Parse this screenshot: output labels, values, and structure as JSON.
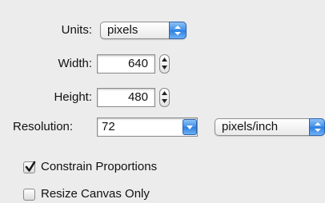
{
  "units": {
    "label": "Units:",
    "selected": "pixels"
  },
  "width": {
    "label": "Width:",
    "value": "640"
  },
  "height": {
    "label": "Height:",
    "value": "480"
  },
  "resolution": {
    "label": "Resolution:",
    "value": "72",
    "unit_selected": "pixels/inch"
  },
  "options": {
    "constrain": {
      "label": "Constrain Proportions",
      "checked": true
    },
    "resize_canvas": {
      "label": "Resize Canvas Only",
      "checked": false
    }
  },
  "colors": {
    "accent": "#3e8ee8",
    "background": "#ececec"
  }
}
